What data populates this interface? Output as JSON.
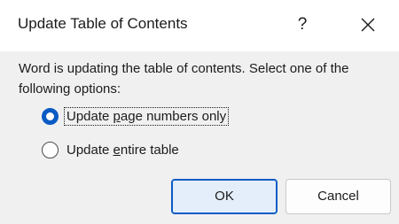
{
  "dialog": {
    "title": "Update Table of Contents",
    "help_label": "?",
    "message": "Word is updating the table of contents.  Select one of the following options:",
    "options": [
      {
        "label_before": "Update ",
        "label_accel": "p",
        "label_after": "age numbers only",
        "selected": true
      },
      {
        "label_before": "Update ",
        "label_accel": "e",
        "label_after": "ntire table",
        "selected": false
      }
    ],
    "ok_label": "OK",
    "cancel_label": "Cancel",
    "icons": {
      "help": "help-icon",
      "close": "close-icon"
    },
    "colors": {
      "accent": "#0a5bc4",
      "body_bg": "#f0f0f0",
      "ok_bg": "#e4eefa"
    }
  }
}
